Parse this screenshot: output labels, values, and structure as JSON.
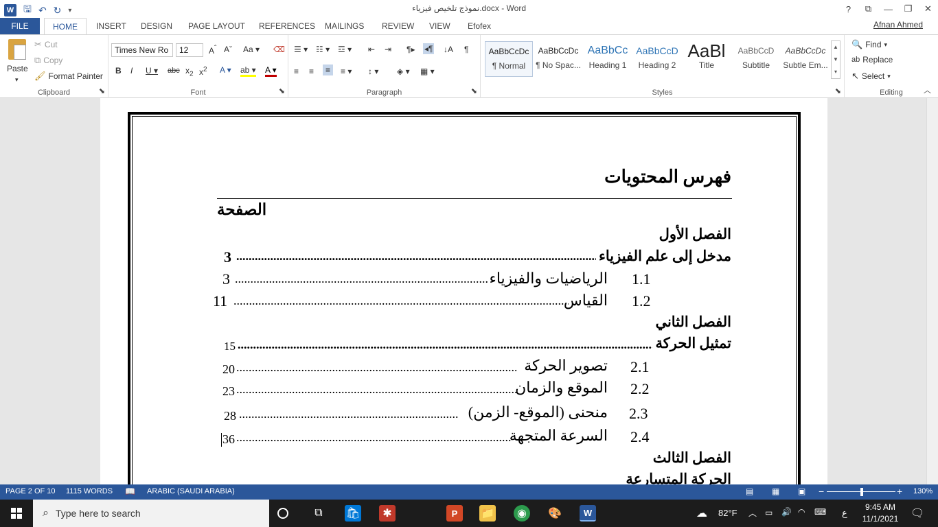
{
  "titlebar": {
    "title": "نموذج تلخيص فيزياء.docx - Word",
    "app_icon": "W",
    "controls": [
      "?",
      "⧉",
      "—",
      "❐",
      "✕"
    ]
  },
  "tabs": {
    "file": "FILE",
    "items": [
      "HOME",
      "INSERT",
      "DESIGN",
      "PAGE LAYOUT",
      "REFERENCES",
      "MAILINGS",
      "REVIEW",
      "VIEW",
      "Efofex"
    ],
    "user": "Afnan Ahmed"
  },
  "clipboard": {
    "paste": "Paste",
    "cut": "Cut",
    "copy": "Copy",
    "format_painter": "Format Painter",
    "label": "Clipboard"
  },
  "font": {
    "name": "Times New Ro",
    "size": "12",
    "label": "Font"
  },
  "paragraph": {
    "label": "Paragraph"
  },
  "styles": {
    "label": "Styles",
    "items": [
      {
        "preview": "AaBbCcDc",
        "name": "¶ Normal"
      },
      {
        "preview": "AaBbCcDc",
        "name": "¶ No Spac..."
      },
      {
        "preview": "AaBbCc",
        "name": "Heading 1"
      },
      {
        "preview": "AaBbCcD",
        "name": "Heading 2"
      },
      {
        "preview": "AaBl",
        "name": "Title"
      },
      {
        "preview": "AaBbCcD",
        "name": "Subtitle"
      },
      {
        "preview": "AaBbCcDc",
        "name": "Subtle Em..."
      }
    ]
  },
  "editing": {
    "find": "Find",
    "replace": "Replace",
    "select": "Select",
    "label": "Editing"
  },
  "document": {
    "heading": "فهرس المحتويات",
    "page_col": "الصفحة",
    "ch1": "الفصل الأول",
    "ch1_title": "مدخل إلى علم الفيزياء",
    "ch1_page": "3",
    "e11_num": "1.1",
    "e11_text": "الرياضيات والفيزياء",
    "e11_page": "3",
    "e12_num": "1.2",
    "e12_text": "القياس",
    "e12_page": "11",
    "ch2": "الفصل الثاني",
    "ch2_title": "تمثيل الحركة",
    "ch2_page": "15",
    "e21_num": "2.1",
    "e21_text": "تصوير الحركة",
    "e21_page": "20",
    "e22_num": "2.2",
    "e22_text": "الموقع والزمان",
    "e22_page": "23",
    "e23_num": "2.3",
    "e23_text": "منحنى (الموقع- الزمن)",
    "e23_page": "28",
    "e24_num": "2.4",
    "e24_text": "السرعة المتجهة",
    "e24_page": "36",
    "ch3": "الفصل الثالث",
    "ch3_title": "الحركة المتسارعة"
  },
  "status": {
    "page": "PAGE 2 OF 10",
    "words": "1115 WORDS",
    "language": "ARABIC (SAUDI ARABIA)",
    "zoom": "130%"
  },
  "taskbar": {
    "search_placeholder": "Type here to search",
    "weather": "82°F",
    "keyboard": "ع",
    "time": "9:45 AM",
    "date": "11/1/2021"
  }
}
